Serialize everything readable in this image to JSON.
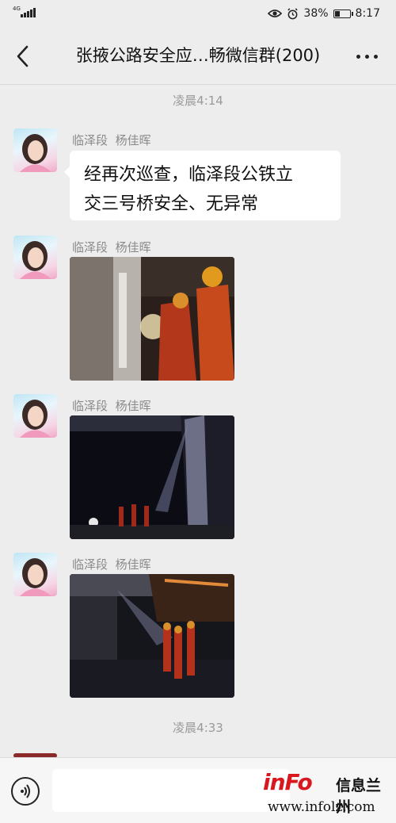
{
  "status_bar": {
    "network": "4G",
    "battery_percent": "38%",
    "battery_level": 0.38,
    "time": "8:17"
  },
  "nav": {
    "title": "张掖公路安全应…畅微信群(200)"
  },
  "timestamps": [
    "凌晨4:14",
    "凌晨4:33"
  ],
  "messages": [
    {
      "section": "临泽段",
      "sender": "杨佳晖",
      "type": "text",
      "text_line1": "经再次巡查，临泽段公铁立",
      "text_line2": "交三号桥安全、无异常"
    },
    {
      "section": "临泽段",
      "sender": "杨佳晖",
      "type": "image",
      "image": "bridge inspection workers with flashlight"
    },
    {
      "section": "临泽段",
      "sender": "杨佳晖",
      "type": "image",
      "image": "night view under bridge with workers"
    },
    {
      "section": "临泽段",
      "sender": "杨佳晖",
      "type": "image",
      "image": "workers in orange vests under bridge at night"
    }
  ],
  "watermark": {
    "logo": "inFo",
    "chinese": "信息兰州",
    "url": "www.infolz.com"
  }
}
